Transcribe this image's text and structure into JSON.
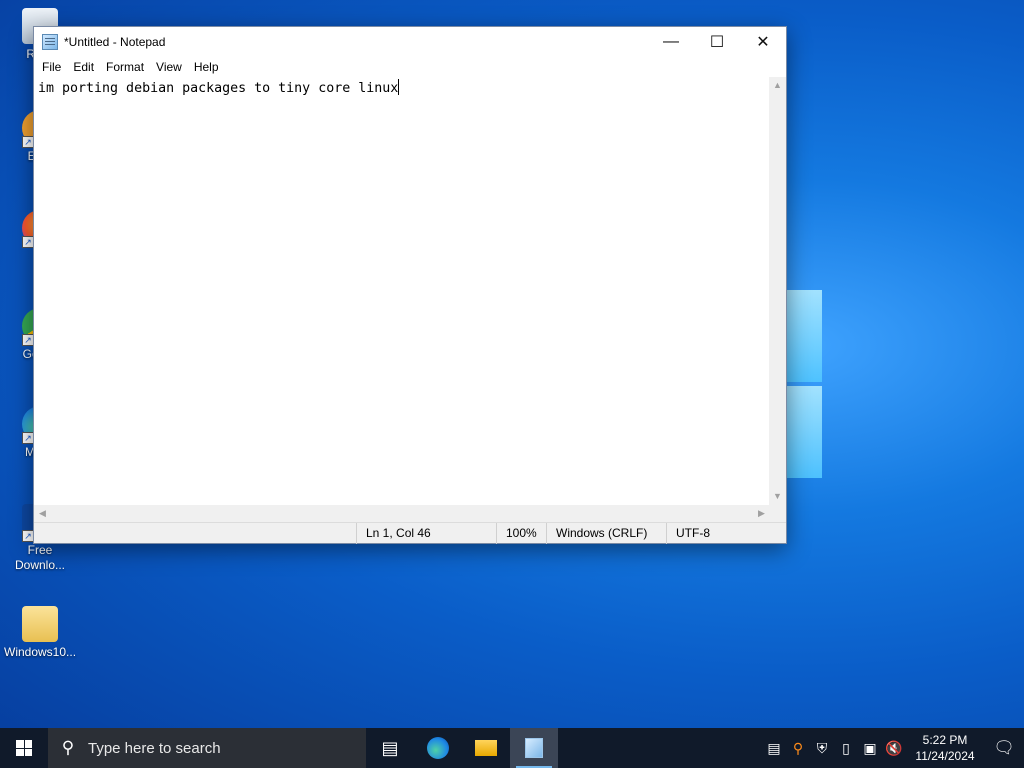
{
  "desktop": {
    "icons": [
      {
        "label": "Recy",
        "color": "#dfe9f3"
      },
      {
        "label": "Ever",
        "color": "#f0a030"
      },
      {
        "label": "Fi",
        "color": "#ff7a2a"
      },
      {
        "label": "Go Ch",
        "color": "#34a853"
      },
      {
        "label": "Mic E",
        "color": "#1e88e5"
      },
      {
        "label": "Free Downlo...",
        "color": "#1565c0"
      },
      {
        "label": "Windows10...",
        "color": "#f3d36b"
      }
    ]
  },
  "notepad": {
    "title": "*Untitled - Notepad",
    "menu": [
      "File",
      "Edit",
      "Format",
      "View",
      "Help"
    ],
    "content": "im porting debian packages to tiny core linux",
    "status": {
      "position": "Ln 1, Col 46",
      "zoom": "100%",
      "line_ending": "Windows (CRLF)",
      "encoding": "UTF-8"
    }
  },
  "taskbar": {
    "search_placeholder": "Type here to search",
    "time": "5:22 PM",
    "date": "11/24/2024"
  }
}
